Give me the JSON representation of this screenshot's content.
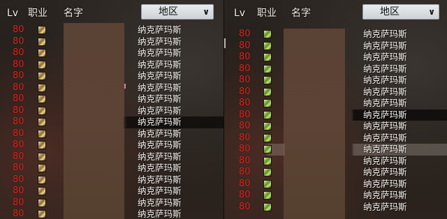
{
  "left_panel": {
    "headers": {
      "lv": "Lv",
      "job": "职业",
      "name": "名字",
      "region": "地区"
    },
    "rows": [
      {
        "lv": "80",
        "region": "纳克萨玛斯"
      },
      {
        "lv": "80",
        "region": "纳克萨玛斯"
      },
      {
        "lv": "80",
        "region": "纳克萨玛斯"
      },
      {
        "lv": "80",
        "region": "纳克萨玛斯"
      },
      {
        "lv": "80",
        "region": "纳克萨玛斯"
      },
      {
        "lv": "80",
        "region": "纳克萨玛斯"
      },
      {
        "lv": "80",
        "region": "纳克萨玛斯"
      },
      {
        "lv": "80",
        "region": "纳克萨玛斯"
      },
      {
        "lv": "80",
        "region": "纳克萨玛斯"
      },
      {
        "lv": "80",
        "region": "纳克萨玛斯"
      },
      {
        "lv": "80",
        "region": "纳克萨玛斯"
      },
      {
        "lv": "80",
        "region": "纳克萨玛斯"
      },
      {
        "lv": "80",
        "region": "纳克萨玛斯"
      },
      {
        "lv": "80",
        "region": "纳克萨玛斯"
      },
      {
        "lv": "80",
        "region": "纳克萨玛斯"
      },
      {
        "lv": "80",
        "region": "纳克萨玛斯"
      },
      {
        "lv": "80",
        "region": "纳克萨玛斯"
      }
    ]
  },
  "right_panel": {
    "headers": {
      "lv": "Lv",
      "job": "职业",
      "name": "名字",
      "region": "地区"
    },
    "rows": [
      {
        "lv": "80",
        "region": "纳克萨玛斯"
      },
      {
        "lv": "80",
        "region": "纳克萨玛斯"
      },
      {
        "lv": "80",
        "region": "纳克萨玛斯"
      },
      {
        "lv": "80",
        "region": "纳克萨玛斯"
      },
      {
        "lv": "80",
        "region": "纳克萨玛斯"
      },
      {
        "lv": "80",
        "region": "纳克萨玛斯"
      },
      {
        "lv": "80",
        "region": "纳克萨玛斯"
      },
      {
        "lv": "80",
        "region": "纳克萨玛斯"
      },
      {
        "lv": "80",
        "region": "纳克萨玛斯"
      },
      {
        "lv": "80",
        "region": "纳克萨玛斯"
      },
      {
        "lv": "80",
        "region": "纳克萨玛斯"
      },
      {
        "lv": "80",
        "region": "纳克萨玛斯"
      },
      {
        "lv": "80",
        "region": "纳克萨玛斯"
      },
      {
        "lv": "80",
        "region": "纳克萨玛斯"
      },
      {
        "lv": "80",
        "region": "纳克萨玛斯"
      },
      {
        "lv": "80",
        "region": "纳克萨玛斯"
      }
    ]
  },
  "dropdown_icon": "chevron-down-icon",
  "colors": {
    "level": "#e0251f",
    "text": "#f6f3ef",
    "mage_icon": "#5d8f2a"
  }
}
